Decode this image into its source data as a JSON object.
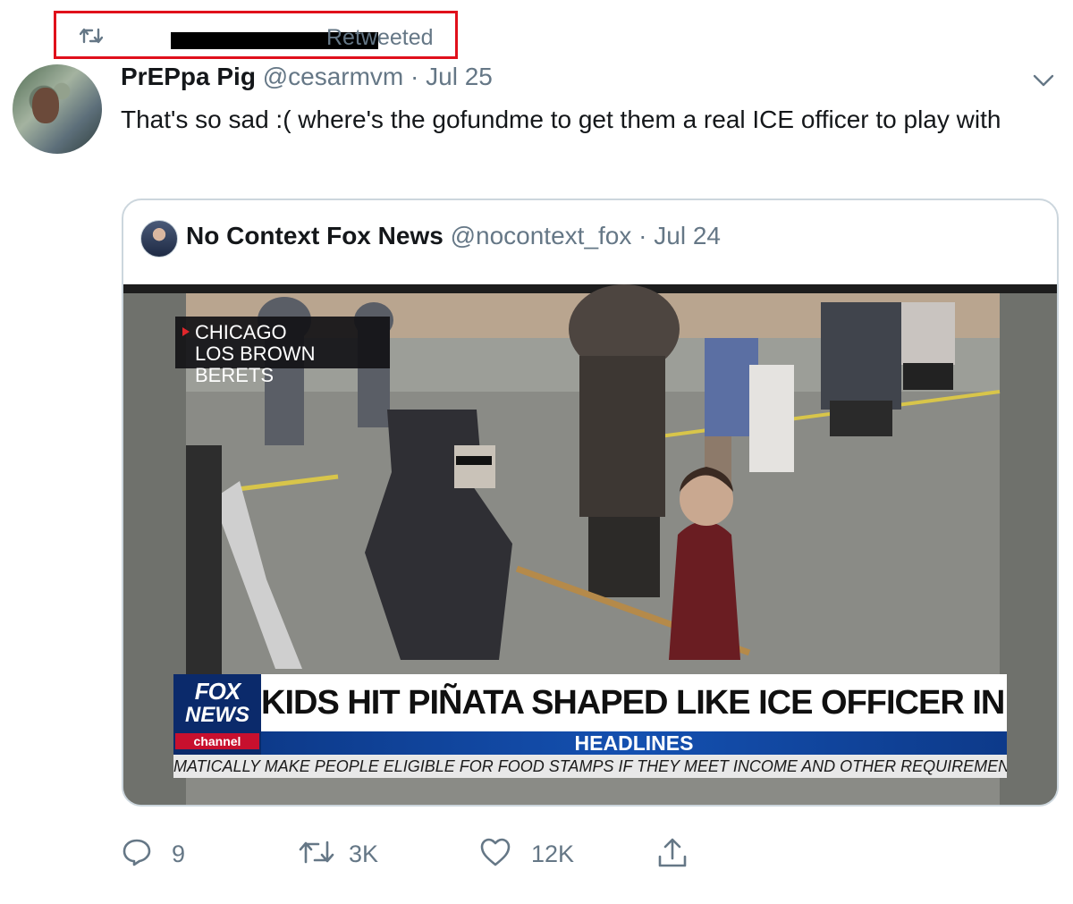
{
  "retweet": {
    "label": "Retweeted"
  },
  "tweet": {
    "display_name": "PrEPpa Pig",
    "handle": "@cesarmvm",
    "separator": "·",
    "date": "Jul 25",
    "text": "That's so sad :( where's the gofundme to get them a real ICE officer to play with"
  },
  "quoted": {
    "display_name": "No Context Fox News",
    "handle": "@nocontext_fox",
    "separator": "·",
    "date": "Jul 24",
    "media": {
      "location_line1": "CHICAGO",
      "location_line2": "LOS BROWN BERETS",
      "logo_line1": "FOX",
      "logo_line2": "NEWS",
      "logo_line3": "channel",
      "headline": "KIDS HIT PIÑATA SHAPED LIKE ICE OFFICER IN CHICAGO",
      "subheadline": "HEADLINES",
      "ticker": "MATICALLY MAKE PEOPLE ELIGIBLE FOR FOOD STAMPS IF THEY MEET INCOME AND OTHER REQUIREMENTS F"
    }
  },
  "actions": {
    "replies": "9",
    "retweets": "3K",
    "likes": "12K"
  },
  "icons": [
    "retweet-icon",
    "chevron-down-icon",
    "reply-icon",
    "like-icon",
    "share-icon"
  ],
  "colors": {
    "highlight": "#e0101b",
    "muted": "#657786",
    "border": "#ccd6dd"
  }
}
